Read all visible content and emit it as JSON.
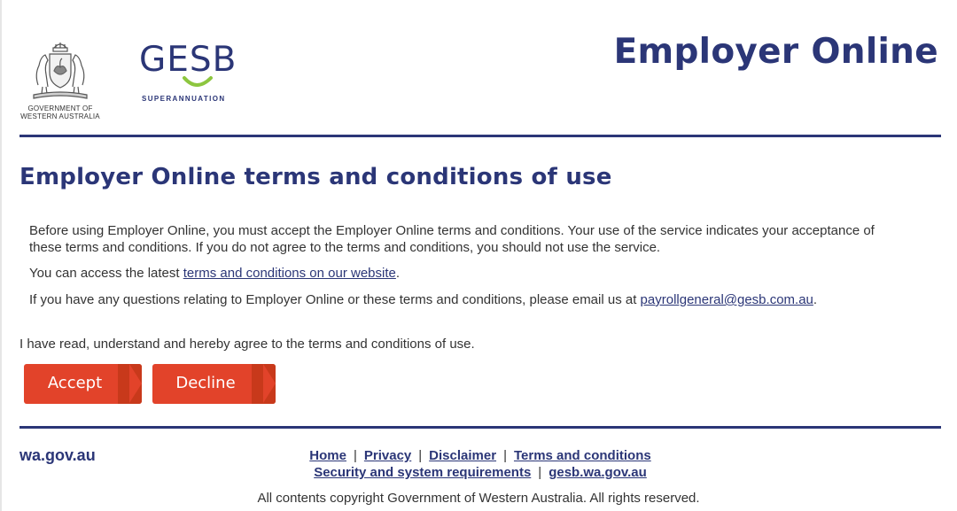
{
  "header": {
    "wa_logo": {
      "line1": "GOVERNMENT OF",
      "line2": "WESTERN AUSTRALIA"
    },
    "gesb_logo": {
      "wordmark": "GESB",
      "tagline": "SUPERANNUATION"
    },
    "app_title": "Employer Online"
  },
  "main": {
    "title": "Employer Online terms and conditions of use",
    "intro": "Before using Employer Online, you must accept the Employer Online terms and conditions. Your use of the service indicates your acceptance of these terms and conditions. If you do not agree to the terms and conditions, you should not use the service.",
    "access_prefix": "You can access the latest ",
    "access_link": "terms and conditions on our website",
    "access_suffix": ".",
    "questions_prefix": "If you have any questions relating to Employer Online or these terms and conditions, please email us at ",
    "questions_email": "payrollgeneral@gesb.com.au",
    "questions_suffix": ".",
    "agreement": "I have read, understand and hereby agree to the terms and conditions of use.",
    "accept_label": "Accept",
    "decline_label": "Decline"
  },
  "footer": {
    "wa_link": "wa.gov.au",
    "links_row1": [
      "Home",
      "Privacy",
      "Disclaimer",
      "Terms and conditions"
    ],
    "links_row2": [
      "Security and system requirements",
      "gesb.wa.gov.au"
    ],
    "separator": "|",
    "copyright": "All contents copyright Government of Western Australia. All rights reserved."
  },
  "colors": {
    "brand_navy": "#2b3677",
    "button_red": "#e2432a",
    "button_tab": "#c8391b",
    "gesb_green": "#8dc63f"
  }
}
